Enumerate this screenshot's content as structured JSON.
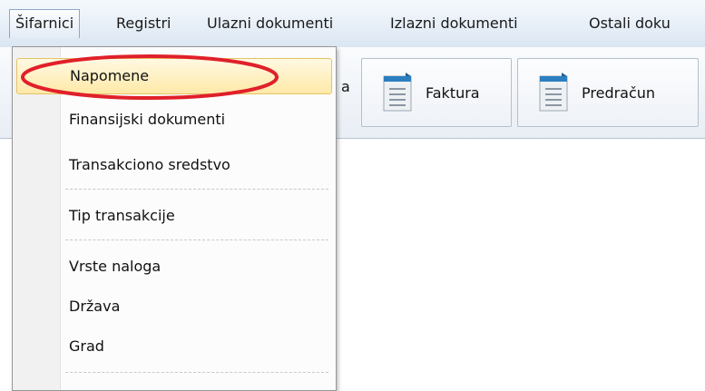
{
  "menubar": {
    "items": [
      {
        "label": "Šifarnici"
      },
      {
        "label": "Registri"
      },
      {
        "label": "Ulazni dokumenti"
      },
      {
        "label": "Izlazni dokumenti"
      },
      {
        "label": "Ostali doku"
      }
    ]
  },
  "toolbar": {
    "partial_label": "a",
    "buttons": [
      {
        "label": "Faktura",
        "icon": "document-icon"
      },
      {
        "label": "Predračun",
        "icon": "document-icon"
      }
    ]
  },
  "dropdown": {
    "items": [
      {
        "label": "Napomene"
      },
      {
        "label": "Finansijski dokumenti"
      },
      {
        "label": "Transakciono sredstvo"
      },
      {
        "label": "Tip transakcije"
      },
      {
        "label": "Vrste naloga"
      },
      {
        "label": "Država"
      },
      {
        "label": "Grad"
      }
    ]
  },
  "annotation": {
    "color": "#e0202a",
    "shape": "ellipse"
  }
}
